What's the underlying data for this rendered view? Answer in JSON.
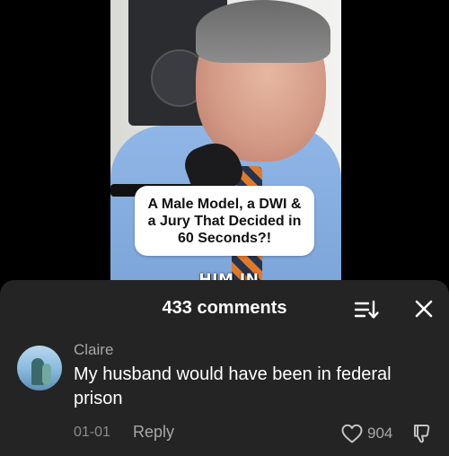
{
  "video": {
    "caption": "A Male Model, a DWI & a Jury That Decided in 60 Seconds?!",
    "subtitle": "HIM IN ONE"
  },
  "comments_panel": {
    "title": "433 comments",
    "sort_icon": "sort-icon",
    "close_icon": "close-icon",
    "background": "#242424"
  },
  "comment": {
    "author": "Claire",
    "text": "My husband would have been in federal prison",
    "date": "01-01",
    "reply_label": "Reply",
    "like_count": "904",
    "like_icon": "heart-icon",
    "dislike_icon": "thumbs-down-icon"
  }
}
